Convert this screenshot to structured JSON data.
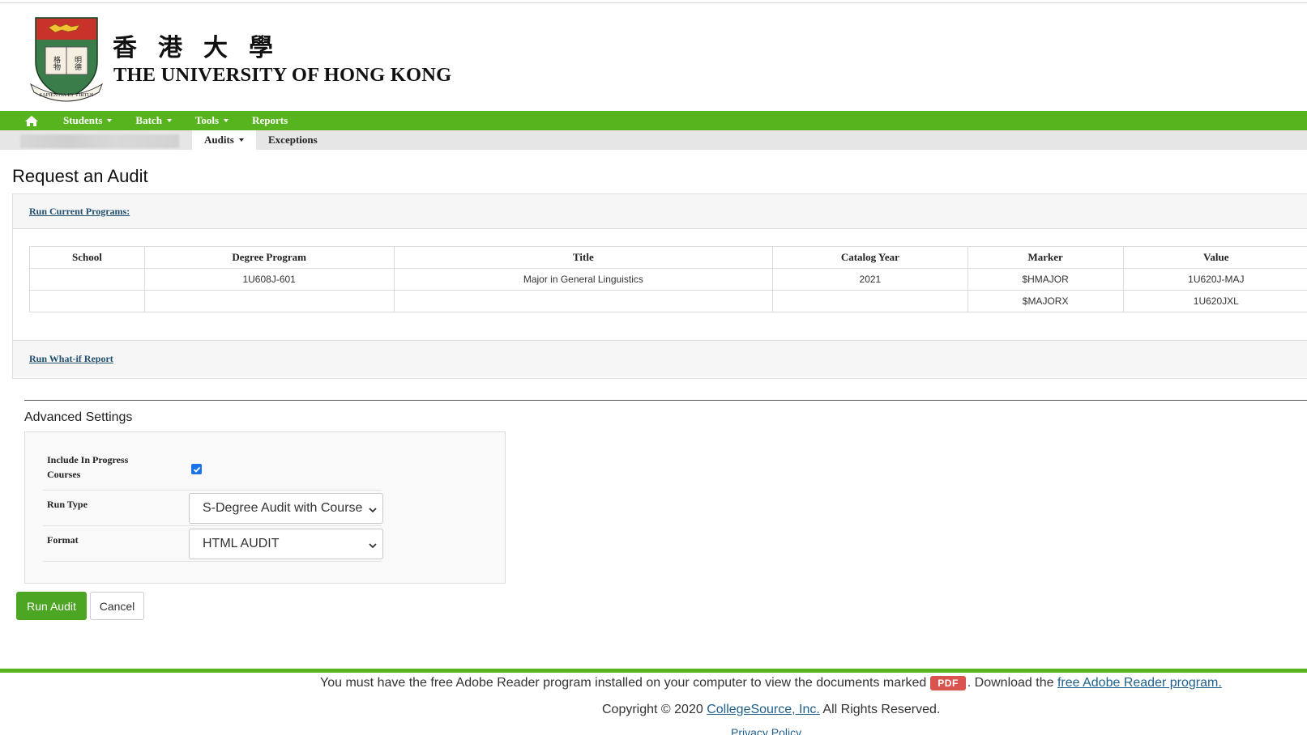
{
  "header": {
    "chinese_name": "香港大學",
    "english_name": "THE UNIVERSITY OF HONG KONG",
    "crest_motto": "SAPIENTIA ET VIRTUS",
    "crest_book": [
      "格物",
      "明德"
    ]
  },
  "nav": {
    "home_icon": "home-icon",
    "items": [
      {
        "label": "Students",
        "has_menu": true
      },
      {
        "label": "Batch",
        "has_menu": true
      },
      {
        "label": "Tools",
        "has_menu": true
      },
      {
        "label": "Reports",
        "has_menu": false
      }
    ]
  },
  "subnav": {
    "tabs": [
      {
        "label": "Audits",
        "has_menu": true,
        "active": true
      },
      {
        "label": "Exceptions",
        "has_menu": false,
        "active": false
      }
    ]
  },
  "main": {
    "title": "Request an Audit",
    "run_current_label": "Run Current Programs:",
    "run_whatif_label": "Run What-if Report",
    "table": {
      "headers": [
        "School",
        "Degree Program",
        "Title",
        "Catalog Year",
        "Marker",
        "Value"
      ],
      "rows": [
        [
          "",
          "1U608J-601",
          "Major in General Linguistics",
          "2021",
          "$HMAJOR",
          "1U620J-MAJ"
        ],
        [
          "",
          "",
          "",
          "",
          "$MAJORX",
          "1U620JXL"
        ]
      ]
    }
  },
  "advanced": {
    "title": "Advanced Settings",
    "include_in_progress_label": "Include In Progress Courses",
    "include_in_progress_checked": true,
    "run_type_label": "Run Type",
    "run_type_value": "S-Degree Audit with Course",
    "format_label": "Format",
    "format_value": "HTML AUDIT"
  },
  "buttons": {
    "run_audit": "Run Audit",
    "cancel": "Cancel"
  },
  "footer": {
    "adobe_text_before": "You must have the free Adobe Reader program installed on your computer to view the documents marked",
    "pdf_badge": "PDF",
    "adobe_text_after": ". Download the",
    "adobe_link": "free Adobe Reader program.",
    "copyright_before": "Copyright © 2020",
    "copyright_link": "CollegeSource, Inc.",
    "copyright_after": "All Rights Reserved.",
    "privacy_link": "Privacy Policy"
  },
  "colors": {
    "brand_green": "#57b41f",
    "button_green": "#4ca624",
    "link_blue": "#1f4e6e",
    "pdf_red": "#d9534f"
  }
}
